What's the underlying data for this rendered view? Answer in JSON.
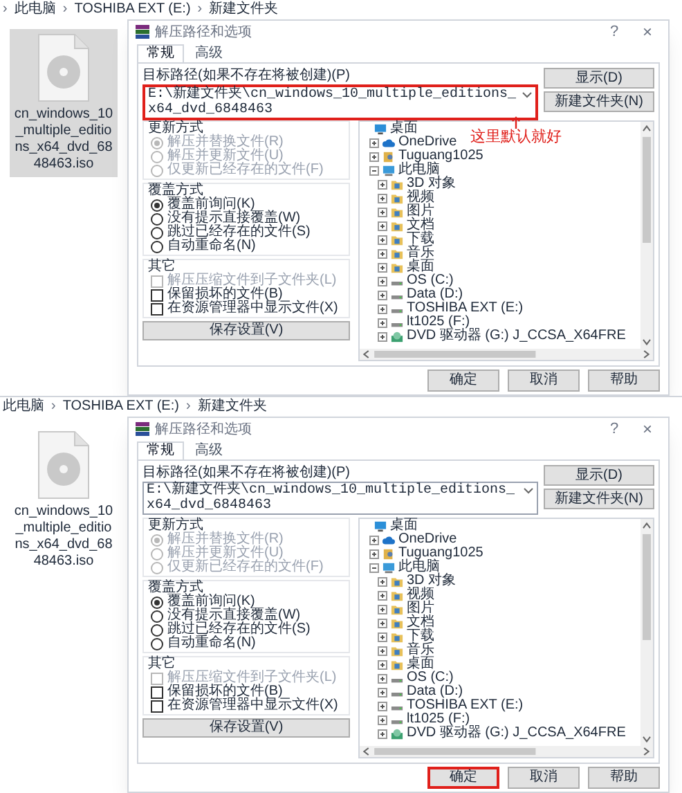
{
  "panels": [
    {
      "breadcrumb": {
        "separator": "›",
        "leading_separator": true,
        "items": [
          "此电脑",
          "TOSHIBA EXT (E:)",
          "新建文件夹"
        ]
      },
      "file": {
        "name": "cn_windows_10_multiple_editions_x64_dvd_6848463.iso",
        "selected": true
      },
      "annotation": {
        "text": "这里默认就好"
      },
      "dialog": {
        "title": "解压路径和选项",
        "help": "?",
        "close": "×",
        "tabs": [
          {
            "label": "常规",
            "selected": true
          },
          {
            "label": "高级",
            "selected": false
          }
        ],
        "path_label": "目标路径(如果不存在将被创建)(P)",
        "path": "E:\\新建文件夹\\cn_windows_10_multiple_editions_x64_dvd_6848463",
        "path_highlighted": true,
        "side_buttons": [
          "显示(D)",
          "新建文件夹(N)"
        ],
        "groups": [
          {
            "title": "更新方式",
            "options": [
              {
                "kind": "radio",
                "label": "解压并替换文件(R)",
                "selected": true,
                "disabled": true
              },
              {
                "kind": "radio",
                "label": "解压并更新文件(U)",
                "selected": false,
                "disabled": true
              },
              {
                "kind": "radio",
                "label": "仅更新已经存在的文件(F)",
                "selected": false,
                "disabled": true
              }
            ]
          },
          {
            "title": "覆盖方式",
            "options": [
              {
                "kind": "radio",
                "label": "覆盖前询问(K)",
                "selected": true,
                "disabled": false
              },
              {
                "kind": "radio",
                "label": "没有提示直接覆盖(W)",
                "selected": false,
                "disabled": false
              },
              {
                "kind": "radio",
                "label": "跳过已经存在的文件(S)",
                "selected": false,
                "disabled": false
              },
              {
                "kind": "radio",
                "label": "自动重命名(N)",
                "selected": false,
                "disabled": false
              }
            ]
          },
          {
            "title": "其它",
            "options": [
              {
                "kind": "checkbox",
                "label": "解压压缩文件到子文件夹(L)",
                "selected": false,
                "disabled": true
              },
              {
                "kind": "checkbox",
                "label": "保留损坏的文件(B)",
                "selected": false,
                "disabled": false
              },
              {
                "kind": "checkbox",
                "label": "在资源管理器中显示文件(X)",
                "selected": false,
                "disabled": false
              }
            ]
          }
        ],
        "save_button": "保存设置(V)",
        "tree": [
          {
            "label": "桌面",
            "kind": "desktop",
            "children": [
              {
                "label": "OneDrive",
                "kind": "cloud",
                "expanded": false
              },
              {
                "label": "Tuguang1025",
                "kind": "user",
                "expanded": false
              },
              {
                "label": "此电脑",
                "kind": "computer",
                "expanded": true,
                "children": [
                  {
                    "label": "3D 对象",
                    "kind": "folder",
                    "expanded": false
                  },
                  {
                    "label": "视频",
                    "kind": "folder",
                    "expanded": false
                  },
                  {
                    "label": "图片",
                    "kind": "folder",
                    "expanded": false
                  },
                  {
                    "label": "文档",
                    "kind": "folder",
                    "expanded": false
                  },
                  {
                    "label": "下载",
                    "kind": "folder",
                    "expanded": false
                  },
                  {
                    "label": "音乐",
                    "kind": "folder",
                    "expanded": false
                  },
                  {
                    "label": "桌面",
                    "kind": "folder",
                    "expanded": false
                  },
                  {
                    "label": "OS (C:)",
                    "kind": "drive",
                    "expanded": false
                  },
                  {
                    "label": "Data (D:)",
                    "kind": "drive",
                    "expanded": false
                  },
                  {
                    "label": "TOSHIBA EXT (E:)",
                    "kind": "drive",
                    "expanded": false
                  },
                  {
                    "label": "lt1025 (F:)",
                    "kind": "drive",
                    "expanded": false
                  },
                  {
                    "label": "DVD 驱动器 (G:) J_CCSA_X64FRE",
                    "kind": "dvd",
                    "expanded": false
                  }
                ]
              }
            ]
          }
        ],
        "buttons": [
          {
            "label": "确定",
            "highlighted": false
          },
          {
            "label": "取消",
            "highlighted": false
          },
          {
            "label": "帮助",
            "highlighted": false
          }
        ]
      }
    },
    {
      "breadcrumb": {
        "separator": "›",
        "leading_separator": false,
        "items": [
          "此电脑",
          "TOSHIBA EXT (E:)",
          "新建文件夹"
        ]
      },
      "file": {
        "name": "cn_windows_10_multiple_editions_x64_dvd_6848463.iso",
        "selected": false
      },
      "dialog": {
        "title": "解压路径和选项",
        "help": "?",
        "close": "×",
        "tabs": [
          {
            "label": "常规",
            "selected": true
          },
          {
            "label": "高级",
            "selected": false
          }
        ],
        "path_label": "目标路径(如果不存在将被创建)(P)",
        "path": "E:\\新建文件夹\\cn_windows_10_multiple_editions_x64_dvd_6848463",
        "path_highlighted": false,
        "side_buttons": [
          "显示(D)",
          "新建文件夹(N)"
        ],
        "groups": [
          {
            "title": "更新方式",
            "options": [
              {
                "kind": "radio",
                "label": "解压并替换文件(R)",
                "selected": true,
                "disabled": true
              },
              {
                "kind": "radio",
                "label": "解压并更新文件(U)",
                "selected": false,
                "disabled": true
              },
              {
                "kind": "radio",
                "label": "仅更新已经存在的文件(F)",
                "selected": false,
                "disabled": true
              }
            ]
          },
          {
            "title": "覆盖方式",
            "options": [
              {
                "kind": "radio",
                "label": "覆盖前询问(K)",
                "selected": true,
                "disabled": false
              },
              {
                "kind": "radio",
                "label": "没有提示直接覆盖(W)",
                "selected": false,
                "disabled": false
              },
              {
                "kind": "radio",
                "label": "跳过已经存在的文件(S)",
                "selected": false,
                "disabled": false
              },
              {
                "kind": "radio",
                "label": "自动重命名(N)",
                "selected": false,
                "disabled": false
              }
            ]
          },
          {
            "title": "其它",
            "options": [
              {
                "kind": "checkbox",
                "label": "解压压缩文件到子文件夹(L)",
                "selected": false,
                "disabled": true
              },
              {
                "kind": "checkbox",
                "label": "保留损坏的文件(B)",
                "selected": false,
                "disabled": false
              },
              {
                "kind": "checkbox",
                "label": "在资源管理器中显示文件(X)",
                "selected": false,
                "disabled": false
              }
            ]
          }
        ],
        "save_button": "保存设置(V)",
        "tree": [
          {
            "label": "桌面",
            "kind": "desktop",
            "children": [
              {
                "label": "OneDrive",
                "kind": "cloud",
                "expanded": false
              },
              {
                "label": "Tuguang1025",
                "kind": "user",
                "expanded": false
              },
              {
                "label": "此电脑",
                "kind": "computer",
                "expanded": true,
                "children": [
                  {
                    "label": "3D 对象",
                    "kind": "folder",
                    "expanded": false
                  },
                  {
                    "label": "视频",
                    "kind": "folder",
                    "expanded": false
                  },
                  {
                    "label": "图片",
                    "kind": "folder",
                    "expanded": false
                  },
                  {
                    "label": "文档",
                    "kind": "folder",
                    "expanded": false
                  },
                  {
                    "label": "下载",
                    "kind": "folder",
                    "expanded": false
                  },
                  {
                    "label": "音乐",
                    "kind": "folder",
                    "expanded": false
                  },
                  {
                    "label": "桌面",
                    "kind": "folder",
                    "expanded": false
                  },
                  {
                    "label": "OS (C:)",
                    "kind": "drive",
                    "expanded": false
                  },
                  {
                    "label": "Data (D:)",
                    "kind": "drive",
                    "expanded": false
                  },
                  {
                    "label": "TOSHIBA EXT (E:)",
                    "kind": "drive",
                    "expanded": false
                  },
                  {
                    "label": "lt1025 (F:)",
                    "kind": "drive",
                    "expanded": false
                  },
                  {
                    "label": "DVD 驱动器 (G:) J_CCSA_X64FRE",
                    "kind": "dvd",
                    "expanded": false
                  }
                ]
              }
            ]
          }
        ],
        "buttons": [
          {
            "label": "确定",
            "highlighted": true
          },
          {
            "label": "取消",
            "highlighted": false
          },
          {
            "label": "帮助",
            "highlighted": false
          }
        ]
      }
    }
  ]
}
